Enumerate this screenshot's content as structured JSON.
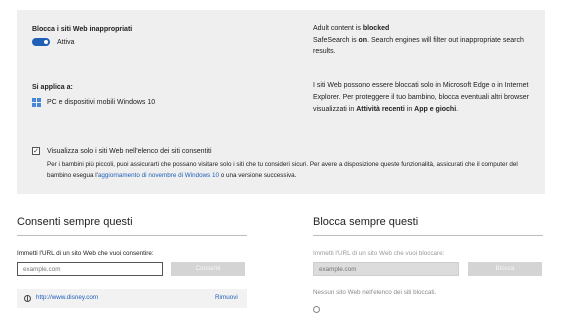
{
  "settings": {
    "block_title": "Blocca i siti Web inappropriati",
    "toggle_state": "Attiva",
    "toggle_on": true,
    "applies_title": "Si applica a:",
    "device_label": "PC e dispositivi mobili Windows 10",
    "status_prefix": "Adult content is ",
    "status_value": "blocked",
    "safesearch_prefix": "SafeSearch is ",
    "safesearch_value": "on",
    "safesearch_suffix": ". Search engines will filter out inappropriate search results.",
    "edge_note_text": "I siti Web possono essere bloccati solo in Microsoft Edge o in Internet Explorer. Per proteggere il tuo bambino, blocca eventuali altri browser visualizzati in ",
    "edge_note_strong_a": "Attività recenti",
    "edge_note_mid": " in ",
    "edge_note_strong_b": "App e giochi",
    "edge_note_end": ".",
    "allowlist_checkbox_label": "Visualizza solo i siti Web nell'elenco dei siti consentiti",
    "allowlist_checked": true,
    "allowlist_desc_before": "Per i bambini più piccoli, puoi assicurarti che possano visitare solo i siti che tu consideri sicuri. Per avere a disposizione queste funzionalità, assicurati che il computer del bambino esegua l'",
    "allowlist_desc_link": "aggiornamento di novembre di Windows 10",
    "allowlist_desc_after": " o una versione successiva."
  },
  "allow": {
    "title": "Consenti sempre questi",
    "prompt": "Immetti l'URL di un sito Web che vuoi consentire:",
    "placeholder": "example.com",
    "button": "Consenti",
    "sites": [
      {
        "url": "http://www.disney.com",
        "action": "Rimuovi"
      }
    ]
  },
  "block": {
    "title": "Blocca sempre questi",
    "prompt": "Immetti l'URL di un sito Web che vuoi bloccare:",
    "placeholder": "example.com",
    "button": "Blocca",
    "empty_message": "Nessun sito Web nell'elenco dei siti bloccati."
  },
  "colors": {
    "accent": "#1f5fb8",
    "panel_bg": "#efefef"
  },
  "icons": {
    "device": "windows-icon",
    "site": "globe-icon",
    "blocked": "blocked-icon",
    "check": "check-icon"
  }
}
